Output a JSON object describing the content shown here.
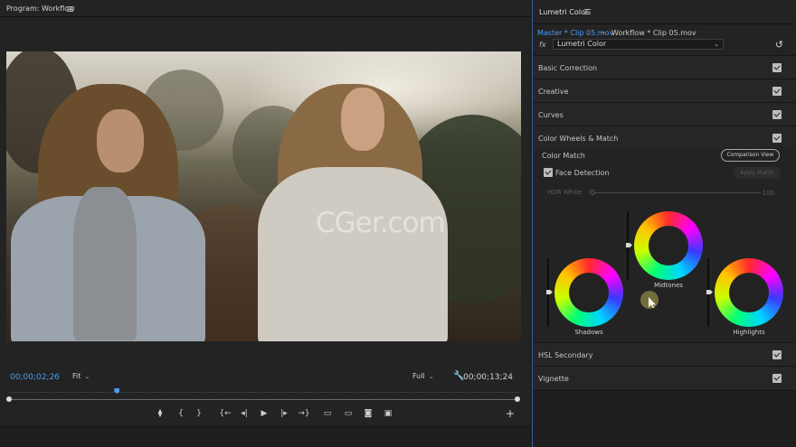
{
  "program": {
    "title": "Program: Workflow",
    "timecode_current": "00;00;02;26",
    "fit_select": "Fit",
    "quality_select": "Full",
    "timecode_duration": "00;00;13;24",
    "watermark": "CGer.com",
    "transport": {
      "marker": "⧫",
      "mark_in": "{",
      "mark_out": "}",
      "go_to_in": "{←",
      "step_back": "◂|",
      "play": "▶",
      "step_forward": "|▸",
      "go_to_out": "→}",
      "lift": "▭",
      "extract": "▭",
      "export_frame": "◙",
      "compare": "▣",
      "add": "+"
    },
    "playhead_position": 0.212
  },
  "lumetri": {
    "title": "Lumetri Color",
    "clip_master": "Master * Clip 05.mov",
    "clip_workflow": "Workflow * Clip 05.mov",
    "fx_label": "fx",
    "effect_select": "Lumetri Color",
    "sections": [
      {
        "label": "Basic Correction",
        "checked": true
      },
      {
        "label": "Creative",
        "checked": true
      },
      {
        "label": "Curves",
        "checked": true
      },
      {
        "label": "Color Wheels & Match",
        "checked": true
      }
    ],
    "color_match": {
      "label": "Color Match",
      "comparison_button": "Comparison View",
      "face_detection_label": "Face Detection",
      "face_detection_checked": true,
      "apply_button": "Apply Match"
    },
    "hdr_white": {
      "label": "HDR White",
      "value": "100"
    },
    "wheels": {
      "midtones": "Midtones",
      "shadows": "Shadows",
      "highlights": "Highlights"
    },
    "bottom_sections": [
      {
        "label": "HSL Secondary",
        "checked": true
      },
      {
        "label": "Vignette",
        "checked": true
      }
    ]
  }
}
